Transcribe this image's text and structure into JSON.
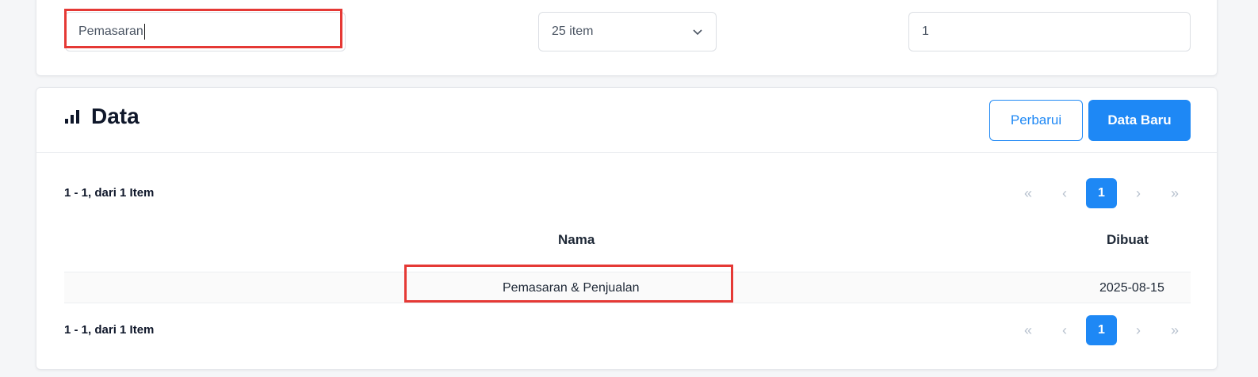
{
  "filters": {
    "search_value": "Pemasaran",
    "per_page": "25 item",
    "page_value": "1"
  },
  "data_section": {
    "title": "Data",
    "refresh_label": "Perbarui",
    "new_label": "Data Baru"
  },
  "pagination": {
    "range_text": "1 - 1, dari 1 Item",
    "first": "«",
    "prev": "‹",
    "current": "1",
    "next": "›",
    "last": "»"
  },
  "table": {
    "headers": {
      "name": "Nama",
      "created": "Dibuat"
    },
    "rows": [
      {
        "name": "Pemasaran & Penjualan",
        "created": "2025-08-15"
      }
    ]
  },
  "colors": {
    "accent": "#1e88f5",
    "highlight": "#e53935"
  }
}
